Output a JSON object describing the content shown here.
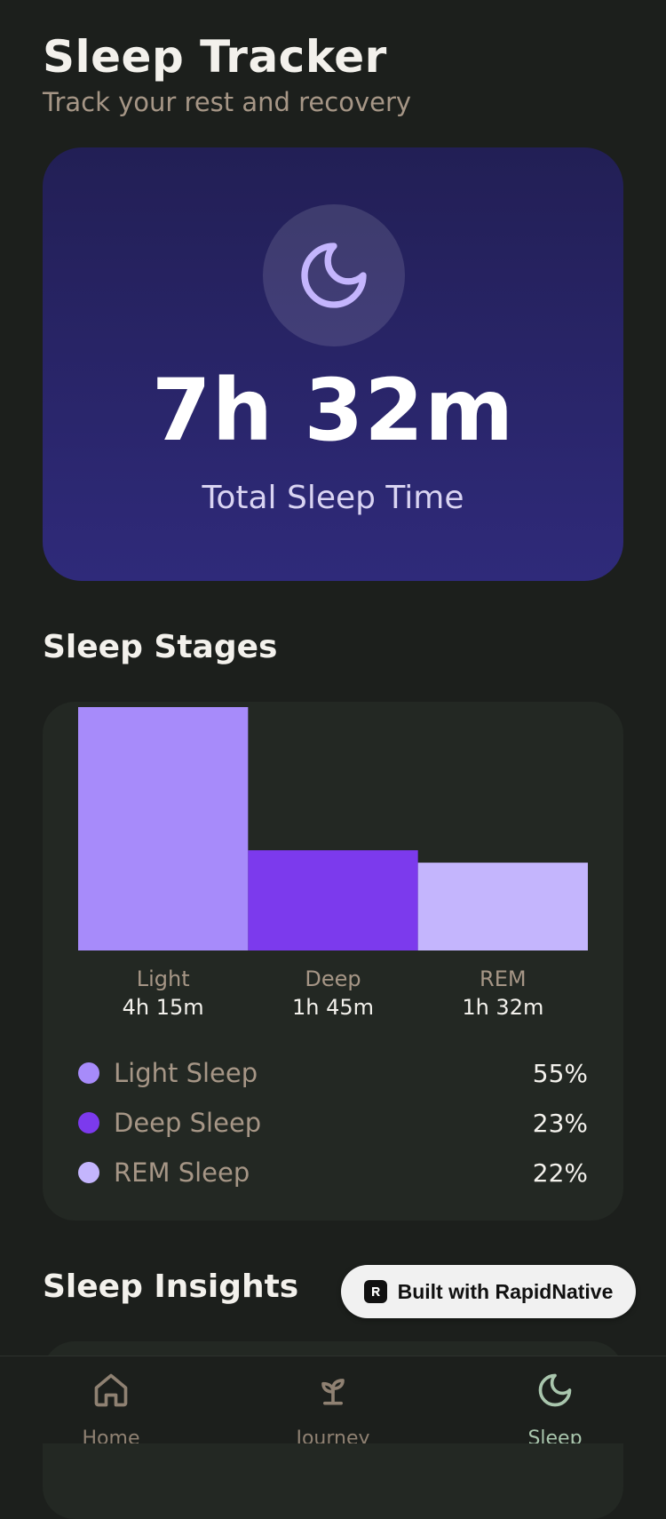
{
  "header": {
    "title": "Sleep Tracker",
    "subtitle": "Track your rest and recovery"
  },
  "summary": {
    "icon": "moon-icon",
    "value": "7h 32m",
    "label": "Total Sleep Time"
  },
  "sections": {
    "stages_title": "Sleep Stages",
    "insights_title": "Sleep Insights"
  },
  "chart_data": {
    "type": "bar",
    "categories": [
      "Light",
      "Deep",
      "REM"
    ],
    "values": [
      255,
      105,
      92
    ],
    "duration_labels": [
      "4h 15m",
      "1h 45m",
      "1h 32m"
    ],
    "colors": [
      "#a78bfa",
      "#7c3aed",
      "#c4b5fd"
    ],
    "ylim": [
      0,
      255
    ]
  },
  "legend": [
    {
      "label": "Light Sleep",
      "percent": "55%",
      "color": "#a78bfa"
    },
    {
      "label": "Deep Sleep",
      "percent": "23%",
      "color": "#7c3aed"
    },
    {
      "label": "REM Sleep",
      "percent": "22%",
      "color": "#c4b5fd"
    }
  ],
  "badge": {
    "icon": "rapidnative-logo-icon",
    "text": "Built with RapidNative"
  },
  "nav": {
    "items": [
      {
        "label": "Home",
        "icon": "home-icon"
      },
      {
        "label": "Journey",
        "icon": "sprout-icon"
      },
      {
        "label": "Sleep",
        "icon": "moon-icon"
      }
    ],
    "active": "Sleep"
  }
}
